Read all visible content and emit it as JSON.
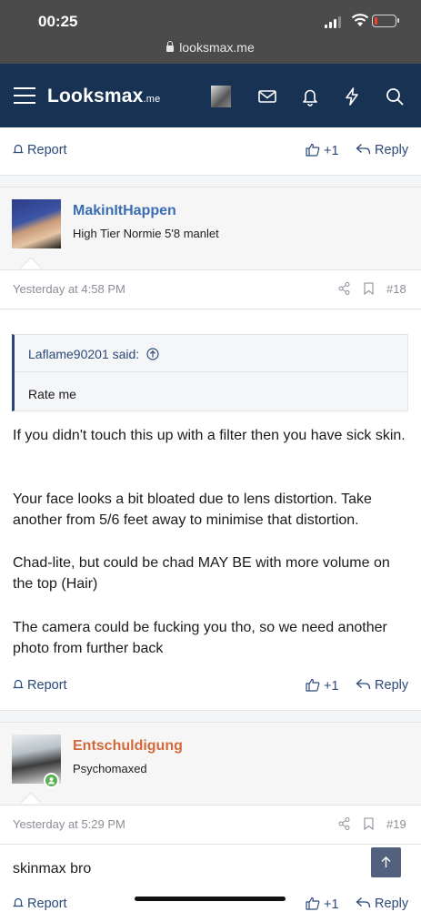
{
  "status": {
    "time": "00:25",
    "url": "looksmax.me"
  },
  "nav": {
    "logo_main": "Looksmax",
    "logo_suffix": ".me"
  },
  "actions": {
    "report": "Report",
    "like_count": "+1",
    "reply": "Reply"
  },
  "posts": [
    {
      "username": "MakinItHappen",
      "user_title": "High Tier Normie 5'8 manlet",
      "time": "Yesterday at 4:58 PM",
      "number": "#18",
      "quote_author": "Laflame90201 said:",
      "quote_text": "Rate me",
      "paragraphs": [
        "If you didn't touch this up with a filter then you have sick skin.",
        "Your face looks a bit bloated due to lens distortion. Take another from 5/6 feet away to minimise that distortion.",
        "Chad-lite, but could be chad MAY BE with more volume on the top (Hair)",
        "The camera could be fucking you tho, so we need another photo from further back"
      ]
    },
    {
      "username": "Entschuldigung",
      "user_title": "Psychomaxed",
      "time": "Yesterday at 5:29 PM",
      "number": "#19",
      "paragraphs": [
        "skinmax bro"
      ]
    }
  ],
  "colors": {
    "nav_bg": "#183254",
    "link": "#2b4a7a",
    "user1": "#3b6db3",
    "user2": "#d2693a"
  }
}
